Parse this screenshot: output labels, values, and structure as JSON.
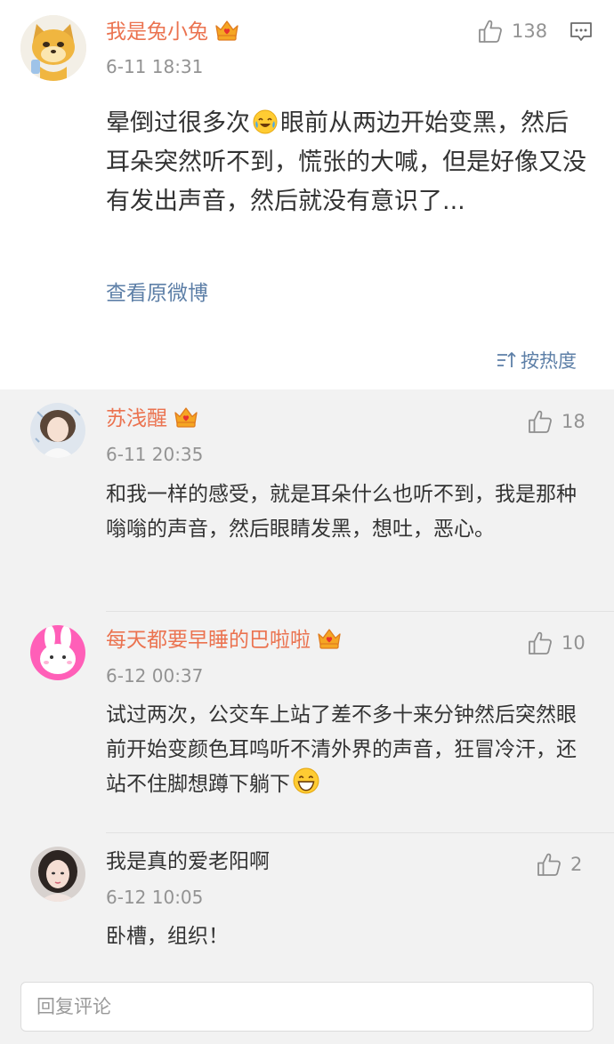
{
  "main_post": {
    "username": "我是兔小兔",
    "time": "6-11 18:31",
    "likes": "138",
    "text_before_emoji": "晕倒过很多次",
    "text_after_emoji": "眼前从两边开始变黑，然后耳朵突然听不到，慌张的大喊，但是好像又没有发出声音，然后就没有意识了...",
    "view_original": "查看原微博",
    "sort_label": "按热度"
  },
  "comments": [
    {
      "username": "苏浅醒",
      "time": "6-11 20:35",
      "likes": "18",
      "text": "和我一样的感受，就是耳朵什么也听不到，我是那种嗡嗡的声音，然后眼睛发黑，想吐，恶心。"
    },
    {
      "username": "每天都要早睡的巴啦啦",
      "time": "6-12 00:37",
      "likes": "10",
      "text": "试过两次，公交车上站了差不多十来分钟然后突然眼前开始变颜色耳鸣听不清外界的声音，狂冒冷汗，还站不住脚想蹲下躺下"
    },
    {
      "username": "我是真的爱老阳啊",
      "time": "6-12 10:05",
      "likes": "2",
      "text": "卧槽，组织！"
    }
  ],
  "reply_placeholder": "回复评论",
  "colors": {
    "username_accent": "#eb7350",
    "link": "#5d7fa7",
    "meta_gray": "#939393",
    "comment_bg": "#f2f2f2"
  }
}
